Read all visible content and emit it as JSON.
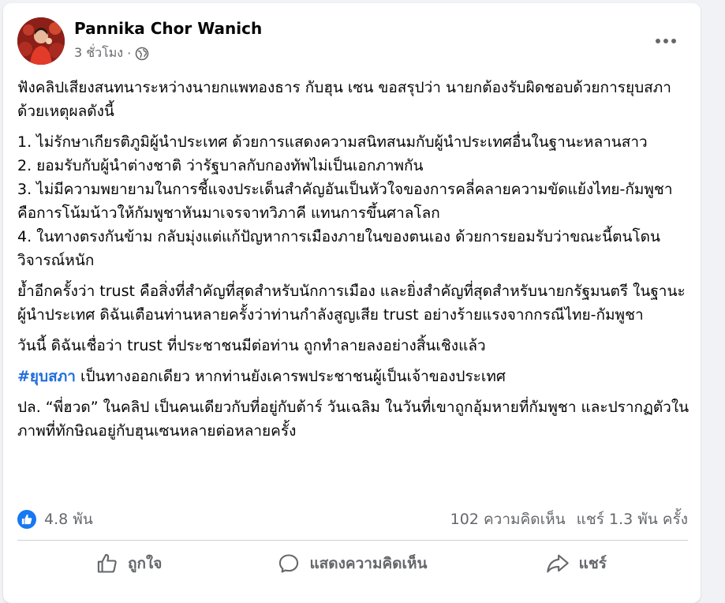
{
  "post": {
    "author": "Pannika Chor Wanich",
    "time": "3 ชั่วโมง",
    "separator": "·",
    "privacy_icon": "globe-icon",
    "menu_icon": "more-horizontal-icon",
    "paragraphs": [
      "ฟังคลิปเสียงสนทนาระหว่างนายกแพทองธาร กับฮุน เซน ขอสรุปว่า นายกต้องรับผิดชอบด้วยการยุบสภา ด้วยเหตุผลดังนี้",
      "1. ไม่รักษาเกียรติภูมิผู้นำประเทศ ด้วยการแสดงความสนิทสนมกับผู้นำประเทศอื่นในฐานะหลานสาว\n2. ยอมรับกับผู้นำต่างชาติ ว่ารัฐบาลกับกองทัพไม่เป็นเอกภาพกัน\n3. ไม่มีความพยายามในการชี้แจงประเด็นสำคัญอันเป็นหัวใจของการคลี่คลายความขัดแย้งไทย-กัมพูชา คือการโน้มน้าวให้กัมพูชาหันมาเจรจาทวิภาคี แทนการขึ้นศาลโลก\n4. ในทางตรงกันข้าม กลับมุ่งแต่แก้ปัญหาการเมืองภายในของตนเอง ด้วยการยอมรับว่าขณะนี้ตนโดนวิจารณ์หนัก",
      "ย้ำอีกครั้งว่า trust คือสิ่งที่สำคัญที่สุดสำหรับนักการเมือง และยิ่งสำคัญที่สุดสำหรับนายกรัฐมนตรี ในฐานะผู้นำประเทศ ดิฉันเตือนท่านหลายครั้งว่าท่านกำลังสูญเสีย trust อย่างร้ายแรงจากกรณีไทย-กัมพูชา",
      "วันนี้ ดิฉันเชื่อว่า trust ที่ประชาชนมีต่อท่าน ถูกทำลายลงอย่างสิ้นเชิงแล้ว"
    ],
    "hashtag": "#ยุบสภา",
    "hashtag_rest": " เป็นทางออกเดียว หากท่านยังเคารพประชาชนผู้เป็นเจ้าของประเทศ",
    "ps": "ปล. “พี่ฮวด” ในคลิป เป็นคนเดียวกับที่อยู่กับต้าร์ วันเฉลิม ในวันที่เขาถูกอุ้มหายที่กัมพูชา และปรากฏตัวในภาพที่ทักษิณอยู่กับฮุนเซนหลายต่อหลายครั้ง"
  },
  "stats": {
    "like_icon": "like-badge-icon",
    "likes": "4.8 พัน",
    "comments": "102 ความคิดเห็น",
    "shares": "แชร์ 1.3 พัน ครั้ง"
  },
  "actions": {
    "like": "ถูกใจ",
    "comment": "แสดงความคิดเห็น",
    "share": "แชร์"
  },
  "colors": {
    "hashtag": "#216fdb",
    "like_blue": "#1877f2",
    "secondary_text": "#65676b"
  }
}
